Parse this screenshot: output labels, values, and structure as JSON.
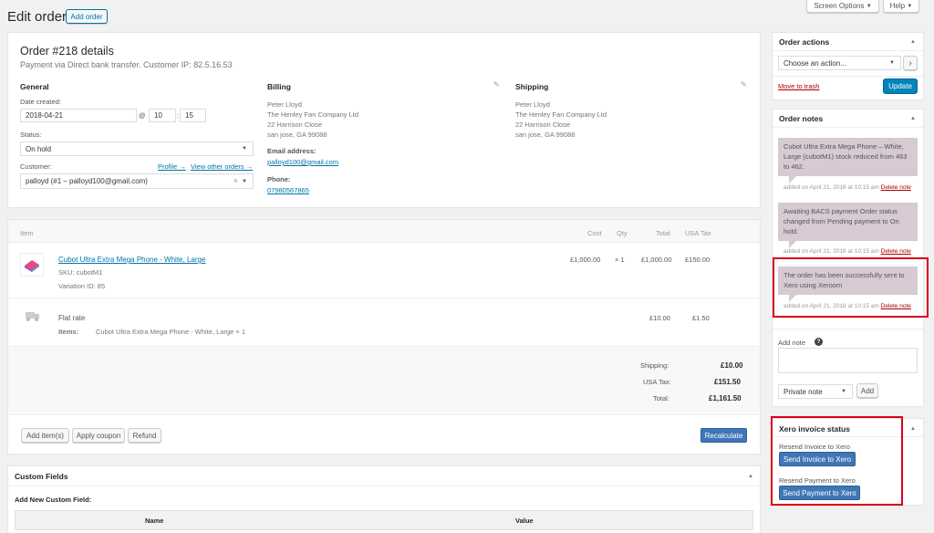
{
  "header": {
    "title": "Edit order",
    "add_order": "Add order",
    "screen_options": "Screen Options",
    "help": "Help"
  },
  "order": {
    "title": "Order #218 details",
    "subtitle": "Payment via Direct bank transfer. Customer IP: 82.5.16.53",
    "general": {
      "heading": "General",
      "date_label": "Date created:",
      "date": "2018-04-21",
      "at": "@",
      "hour": "10",
      "colon": ":",
      "minute": "15",
      "status_label": "Status:",
      "status": "On hold",
      "customer_label": "Customer:",
      "profile_link": "Profile →",
      "view_other_link": "View other orders →",
      "customer": "palloyd (#1 – palloyd100@gmail.com)",
      "clear": "×"
    },
    "billing": {
      "heading": "Billing",
      "lines": [
        "Peter Lloyd",
        "The Henley Fan Company Ltd",
        "22 Harrison Close",
        "san jose, GA 99088"
      ],
      "email_label": "Email address:",
      "email": "palloyd100@gmail.com",
      "phone_label": "Phone:",
      "phone": "07980567865"
    },
    "shipping": {
      "heading": "Shipping",
      "lines": [
        "Peter Lloyd",
        "The Henley Fan Company Ltd",
        "22 Harrison Close",
        "san jose, GA 99088"
      ]
    }
  },
  "items": {
    "columns": {
      "item": "Item",
      "cost": "Cost",
      "qty": "Qty",
      "total": "Total",
      "tax": "USA Tax"
    },
    "product": {
      "name": "Cubot Ultra Extra Mega Phone - White, Large",
      "sku": "SKU: cubotM1",
      "variation": "Variation ID: 85",
      "cost": "£1,000.00",
      "qty": "× 1",
      "total": "£1,000.00",
      "tax": "£150.00"
    },
    "shipping_line": {
      "name": "Flat rate",
      "items_label": "Items:",
      "items_value": "Cubot Ultra Extra Mega Phone - White, Large × 1",
      "total": "£10.00",
      "tax": "£1.50"
    },
    "totals": [
      {
        "label": "Shipping:",
        "value": "£10.00"
      },
      {
        "label": "USA Tax:",
        "value": "£151.50"
      },
      {
        "label": "Total:",
        "value": "£1,161.50"
      }
    ],
    "actions": {
      "add_items": "Add item(s)",
      "apply_coupon": "Apply coupon",
      "refund": "Refund",
      "recalculate": "Recalculate"
    }
  },
  "custom_fields": {
    "title": "Custom Fields",
    "add_new": "Add New Custom Field:",
    "col_name": "Name",
    "col_value": "Value"
  },
  "order_actions": {
    "title": "Order actions",
    "select": "Choose an action...",
    "go": "›",
    "trash": "Move to trash",
    "update": "Update"
  },
  "order_notes": {
    "title": "Order notes",
    "notes": [
      {
        "text": "Cubot Ultra Extra Mega Phone – White, Large (cubotM1) stock reduced from 463 to 462.",
        "meta": "added on April 21, 2018 at 10:15 am",
        "delete": "Delete note"
      },
      {
        "text": "Awaiting BACS payment Order status changed from Pending payment to On hold.",
        "meta": "added on April 21, 2018 at 10:15 am",
        "delete": "Delete note"
      },
      {
        "text": "The order has been successfully sent to Xero using Xeroom",
        "meta": "added on April 21, 2018 at 10:15 am",
        "delete": "Delete note"
      }
    ],
    "add_note_label": "Add note",
    "note_type": "Private note",
    "add": "Add"
  },
  "xero": {
    "title": "Xero invoice status",
    "resend_invoice_label": "Resend Invoice to Xero",
    "send_invoice": "Send Invoice to Xero",
    "resend_payment_label": "Resend Payment to Xero",
    "send_payment": "Send Payment to Xero"
  },
  "colors": {
    "primary": "#0085ba",
    "note_bg": "#d7cad2",
    "highlight": "#d9001b",
    "xero_button": "#3f76b6"
  }
}
